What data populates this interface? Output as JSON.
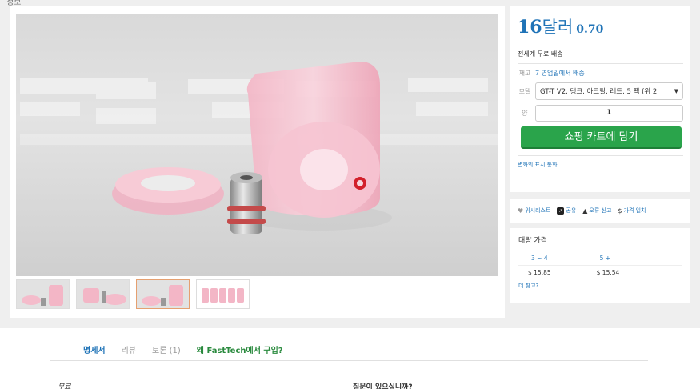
{
  "header": {
    "fragment": "정보"
  },
  "price": {
    "main": "16",
    "currency_word": "달러",
    "cents": "0.70"
  },
  "shipping": {
    "label": "전세계 무료 배송"
  },
  "stock": {
    "label": "재고",
    "value": "7 영업일에서 배송"
  },
  "model": {
    "label": "모델",
    "selected": "GT-T V2, 탱크, 아크릴, 레드, 5 팩 (위 2"
  },
  "quantity": {
    "label": "양",
    "value": "1"
  },
  "cart_button": "쇼핑 카트에 담기",
  "currency_link": "변화의 표시 통화",
  "actions": {
    "wishlist": "위시리스트",
    "share": "공유",
    "report": "오류 신고",
    "price_match": "가격 일치"
  },
  "bulk": {
    "title": "대량 가격",
    "tiers": [
      {
        "range": "3 ~ 4",
        "price": "$ 15.85"
      },
      {
        "range": "5 +",
        "price": "$ 15.54"
      }
    ],
    "find_more": "더 찾고?"
  },
  "tabs": [
    "명세서",
    "리뷰",
    "토론 (1)",
    "왜 FastTech에서 구입?"
  ],
  "lower": {
    "free_label": "무료",
    "question": "질문이 있으십니까?"
  },
  "colors": {
    "accent": "#1f73b7",
    "cart_green": "#2aa44b"
  }
}
